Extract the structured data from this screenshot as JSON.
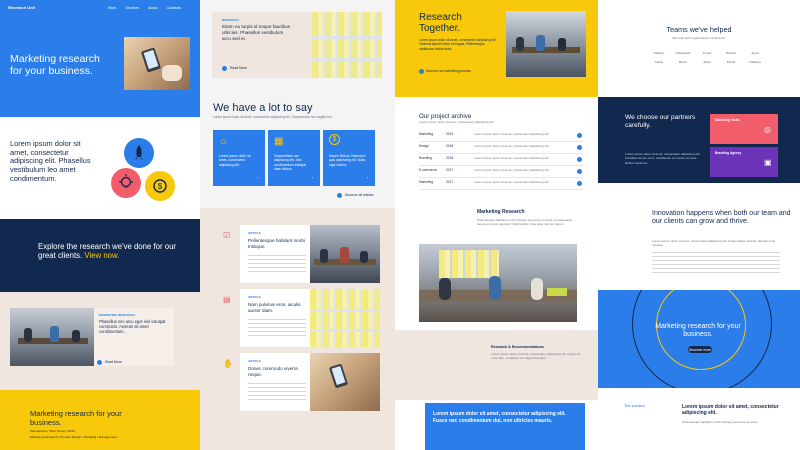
{
  "colors": {
    "blue": "#2b7de9",
    "navy": "#12294f",
    "yellow": "#f8c80a",
    "red": "#f25d6b",
    "purple": "#6b33b8",
    "beige": "#efe6df"
  },
  "hero": {
    "logo": "Research Unit",
    "nav": [
      "Work",
      "Services",
      "About",
      "Contacts"
    ],
    "title": "Marketing research for your business."
  },
  "features": {
    "text": "Lorem ipsum dolor sit amet, consectetur adipiscing elit. Phasellus vestibulum leo amet condimentum."
  },
  "explore": {
    "text": "Explore the research we've done for our great clients.",
    "link": "View now."
  },
  "case1": {
    "tag": "MARKETING RESEARCH",
    "title": "Phasellus nec arcu eget nisl volutpat commodo. Aenean sit amet condimentum.",
    "read_more": "Read More"
  },
  "footer1": {
    "title": "Marketing research for your business.",
    "meta": "Plenaphone | Tiber Group | 2019",
    "tags": "Marketing Research | Product Design | Branding | Management"
  },
  "col2_top": {
    "tag": "RESEARCH",
    "title": "Etiam eu turpis id neque faucibus ultricies. Phasellus vestibulum arcu sed et.",
    "read_more": "Read More"
  },
  "say": {
    "title": "We have a lot to say",
    "sub": "Lorem ipsum dolor sit amet, consectetur adipiscing elit. Suspendisse nec sagittis leo.",
    "cards": [
      {
        "text": "Lorem ipsum dolor sit amet, consectetur adipiscing elit.",
        "icon": "lightbulb-icon"
      },
      {
        "text": "Suspendisse nec adipiscing elit. Sed condimentum tristique diam dictum.",
        "icon": "grid-icon"
      },
      {
        "text": "Mauris finibus, bibendum quis adipiscing elit. Nulla eget viverra.",
        "icon": "dollar-icon"
      }
    ],
    "discover": "Discover all articles"
  },
  "articles": [
    {
      "tag": "ARTICLE",
      "title": "Pellentesque habitant morbi tristique.",
      "icon": "checklist-icon"
    },
    {
      "tag": "ARTICLE",
      "title": "Nam pulvinar eros, iaculis auctor diam.",
      "icon": "chart-icon"
    },
    {
      "tag": "ARTICLE",
      "title": "Donec commodo viverra neque.",
      "icon": "handshake-icon"
    }
  ],
  "together": {
    "title": "Research Together.",
    "sub": "Lorem ipsum dolor sit amet, consectetur adipiscing elit. Vivamus laoreet tortor et magna. Pellentesque vestibulum lectus dolor.",
    "link": "Discover our marketing process"
  },
  "archive": {
    "title": "Our project archive",
    "sub": "Lorem ipsum dolor sit amet, consectetur adipiscing elit.",
    "rows": [
      {
        "name": "Marketing",
        "year": "2019",
        "desc": "Lorem ipsum dolor sit amet, consectetur adipiscing elit."
      },
      {
        "name": "Design",
        "year": "2018",
        "desc": "Lorem ipsum dolor sit amet, consectetur adipiscing elit."
      },
      {
        "name": "Branding",
        "year": "2018",
        "desc": "Lorem ipsum dolor sit amet, consectetur adipiscing elit."
      },
      {
        "name": "E-commerce",
        "year": "2017",
        "desc": "Lorem ipsum dolor sit amet, consectetur adipiscing elit."
      },
      {
        "name": "Marketing",
        "year": "2017",
        "desc": "Lorem ipsum dolor sit amet, consectetur adipiscing elit."
      }
    ]
  },
  "mr": {
    "title": "Marketing Research",
    "text": "Pellentesque habitant morbi tristique senectus et netus et malesuada fames ac turpis egestas. Nulla facilisi. Cras vitae dui nec ipsum."
  },
  "recs": {
    "title": "Research & Recommendations",
    "text": "Lorem ipsum dolor sit amet, consectetur adipiscing elit. Integer at urna nibh. Curabitur vel magna tincidunt."
  },
  "blue_quote": {
    "text": "Lorem ipsum dolor sit amet, consectetur adipiscing elit. Fusce nec condimentum dui, non ultricies mauris."
  },
  "teams": {
    "title": "Teams we've helped",
    "sub": "We work with organizations of all sizes.",
    "logos": [
      "Gallery",
      "Ornament",
      "Crest",
      "Wilder",
      "Apex",
      "Vesta",
      "Brew",
      "Atlas",
      "Merit",
      "Nimbus"
    ]
  },
  "partners": {
    "title": "We choose our partners carefully.",
    "text": "Lorem ipsum dolor sit amet, consectetur adipiscing elit. Curabitur ac leo nunc. Vestibulum et mauris vel ante finibus maximus.",
    "cards": [
      {
        "label": "Marketing Goals",
        "icon": "target-icon"
      },
      {
        "label": "Branding Agency",
        "icon": "layout-icon"
      }
    ]
  },
  "innovation": {
    "title": "Innovation happens when both our team and our clients can grow and thrive.",
    "text": "Lorem ipsum dolor sit amet, consectetur adipiscing elit. Suspendisse potenti. Aliquam erat volutpat."
  },
  "circle": {
    "title": "Marketing research for your business.",
    "button": "Discover more"
  },
  "solution": {
    "label": "The solution",
    "title": "Lorem ipsum dolor sit amet, consectetur adipiscing elit.",
    "text": "Pellentesque habitant morbi tristique senectus et netus."
  }
}
